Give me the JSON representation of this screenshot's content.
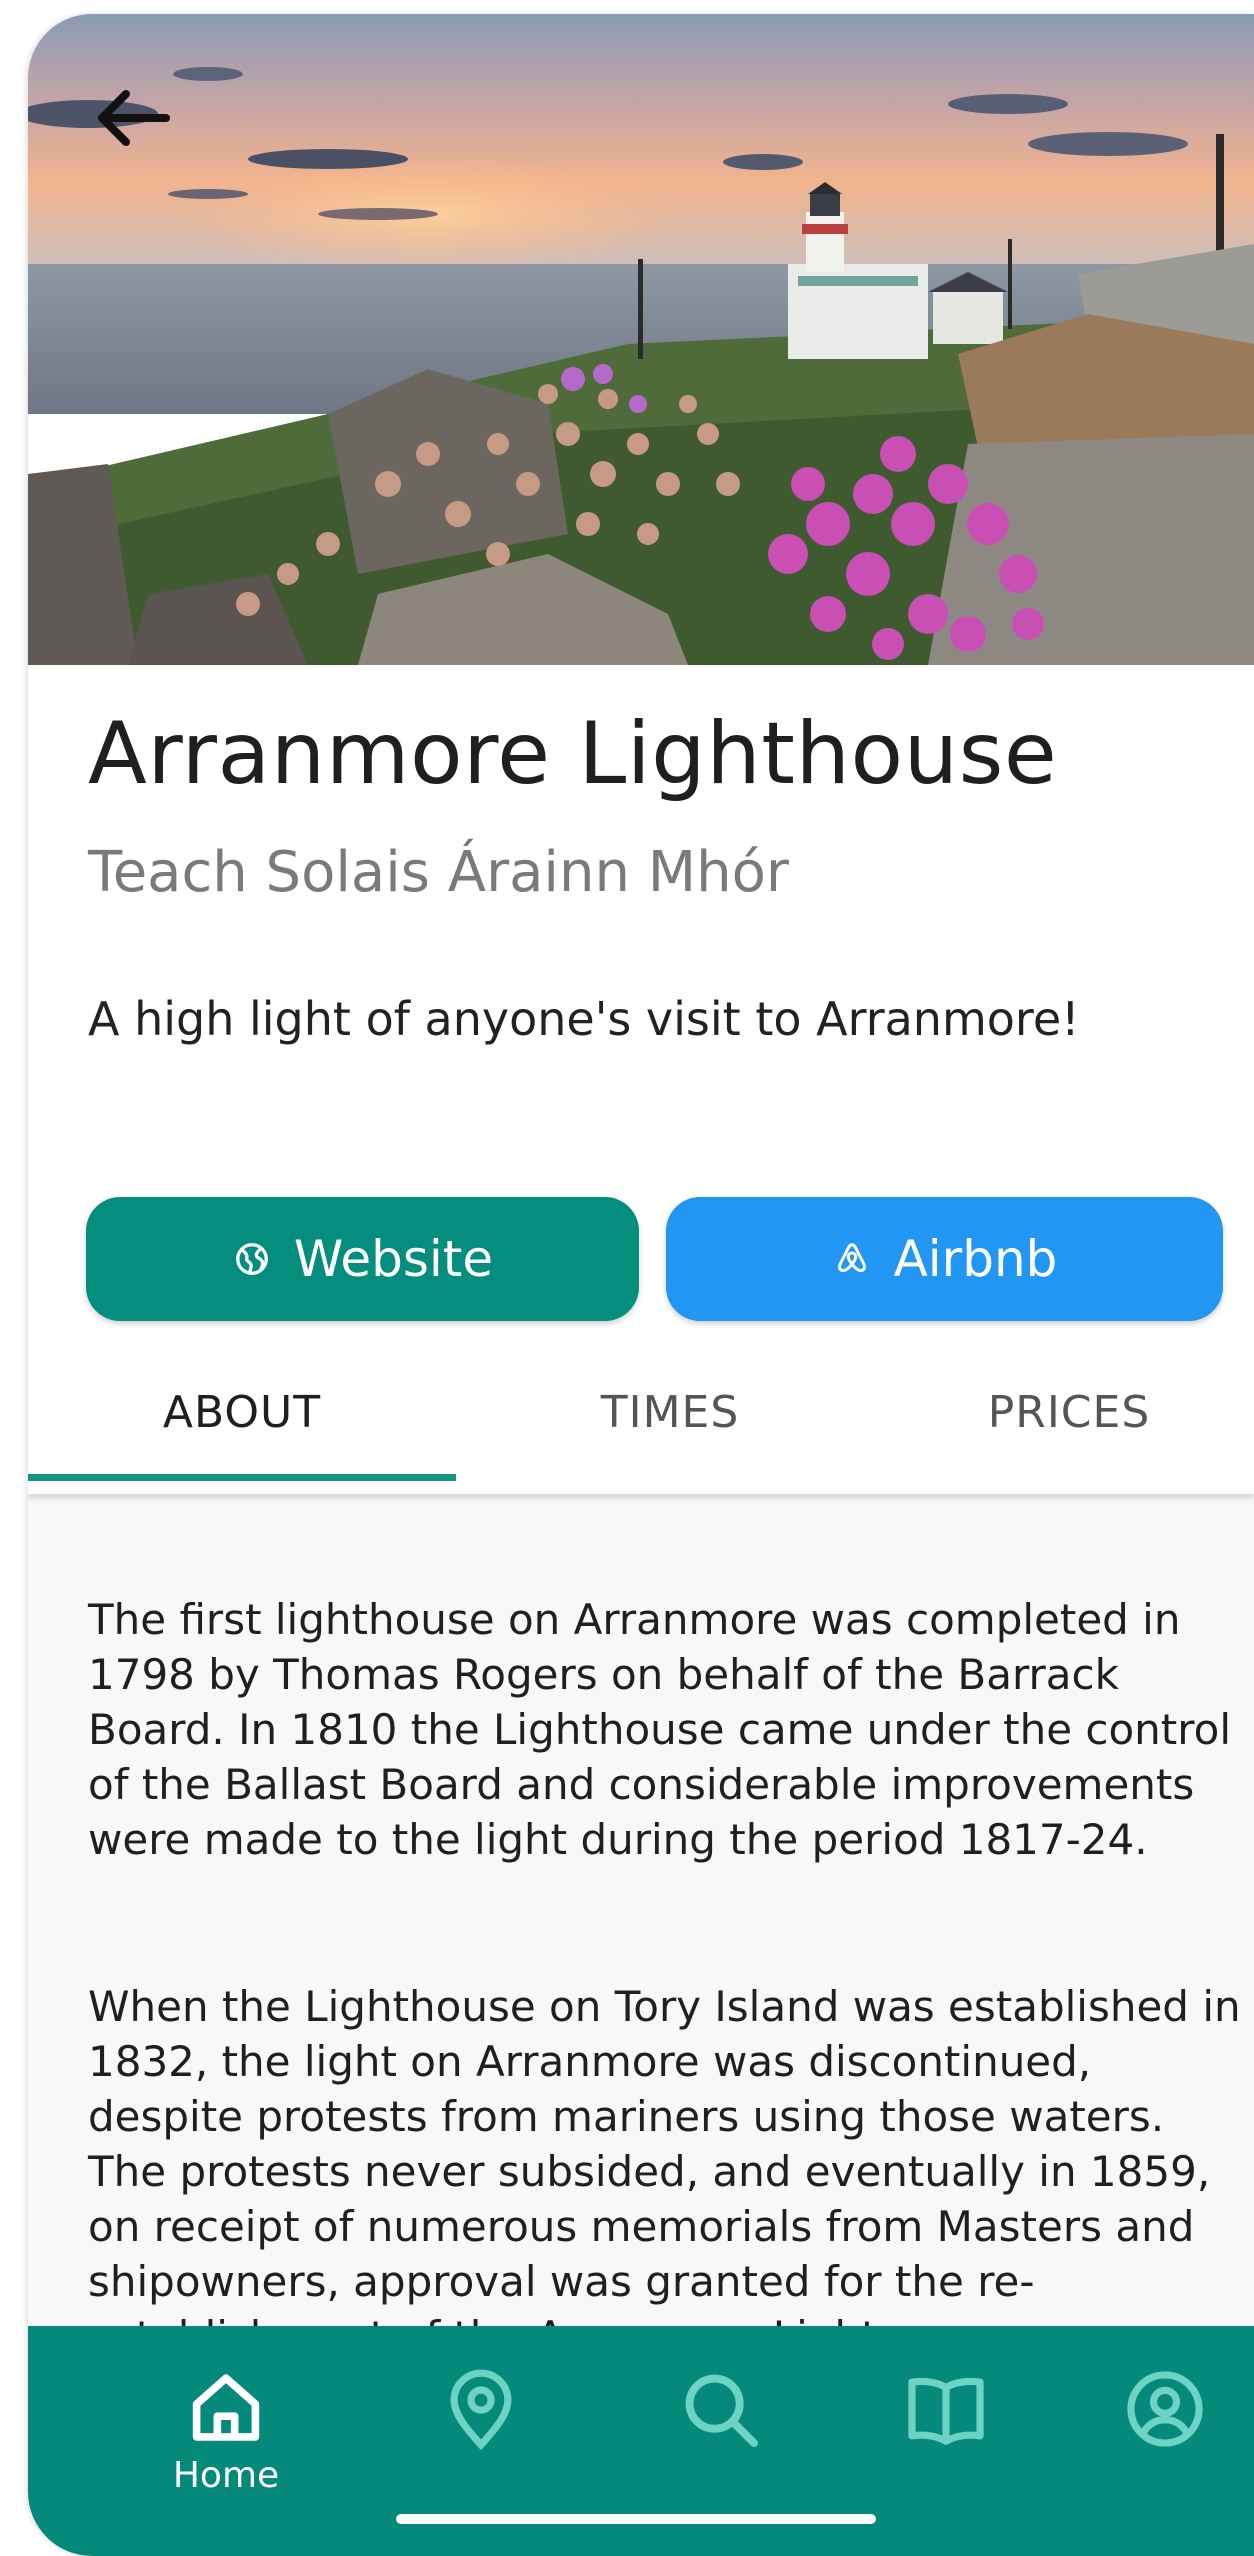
{
  "place": {
    "title": "Arranmore Lighthouse",
    "subtitle": "Teach Solais Árainn Mhór",
    "tagline": "A high light of anyone's visit to Arranmore!"
  },
  "actions": {
    "website_label": "Website",
    "airbnb_label": "Airbnb"
  },
  "tabs": [
    {
      "label": "ABOUT",
      "selected": true
    },
    {
      "label": "TIMES",
      "selected": false
    },
    {
      "label": "PRICES",
      "selected": false
    }
  ],
  "about": {
    "paragraphs": [
      "The first lighthouse on Arranmore was completed in 1798 by Thomas Rogers on behalf of the Barrack Board. In 1810 the Lighthouse came under the control of the Ballast Board and considerable improvements were made to the light during the period 1817-24.",
      "When the Lighthouse on Tory Island was established in 1832, the light on Arranmore was discontinued, despite protests from mariners using those waters. The protests never subsided, and eventually in 1859, on receipt of numerous memorials from Masters and shipowners, approval was granted for the re-establishment of the Arranmore Light."
    ]
  },
  "bottom_nav": {
    "items": [
      {
        "icon": "home-icon",
        "label": "Home",
        "active": true
      },
      {
        "icon": "map-pin-icon",
        "label": "",
        "active": false
      },
      {
        "icon": "search-icon",
        "label": "",
        "active": false
      },
      {
        "icon": "book-icon",
        "label": "",
        "active": false
      },
      {
        "icon": "account-icon",
        "label": "",
        "active": false
      }
    ]
  },
  "colors": {
    "teal": "#058e7e",
    "blue": "#2196f3",
    "nav_background": "#05897a"
  }
}
